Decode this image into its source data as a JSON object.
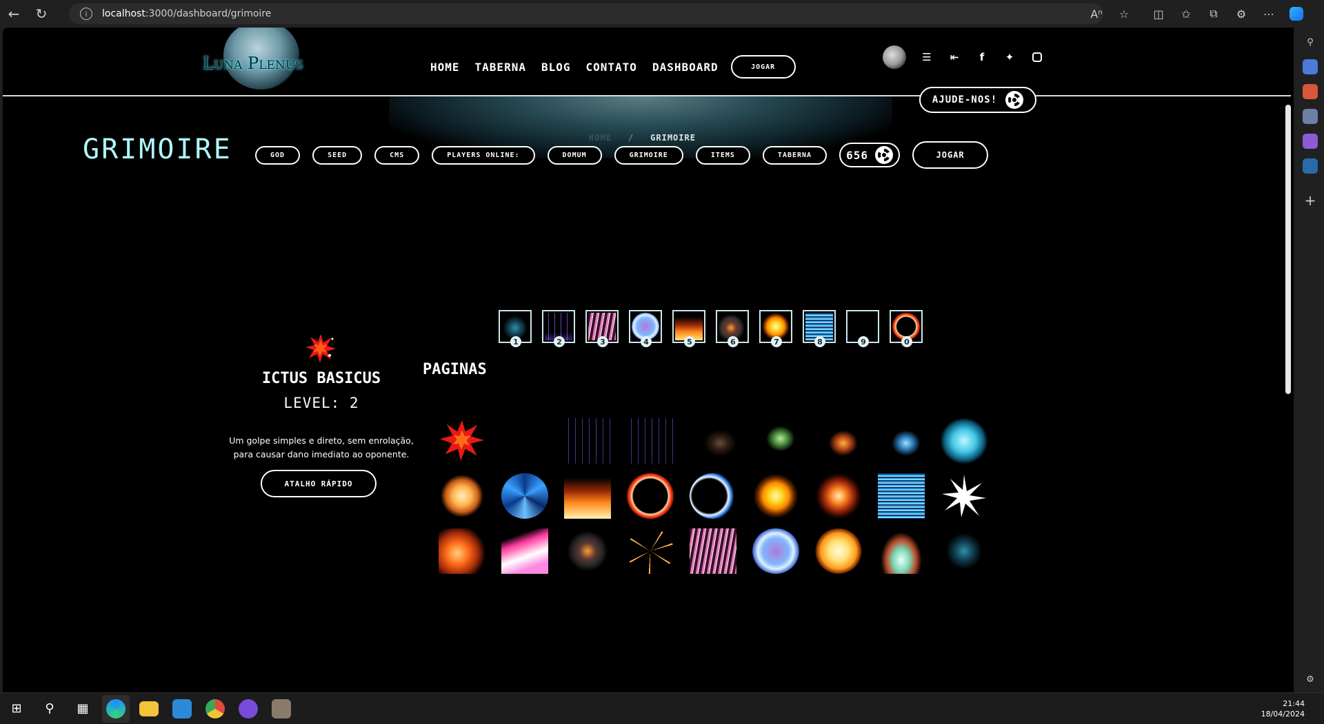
{
  "browser": {
    "url_host": "localhost",
    "url_path": ":3000/dashboard/grimoire"
  },
  "header": {
    "logo_text": "Luna Plenus",
    "nav": [
      "HOME",
      "TABERNA",
      "BLOG",
      "CONTATO",
      "DASHBOARD"
    ],
    "play_label": "JOGAR"
  },
  "hero": {
    "breadcrumb_home": "HOME",
    "breadcrumb_sep": "/",
    "breadcrumb_current": "GRIMOIRE",
    "help_label": "AJUDE-NOS!"
  },
  "page": {
    "title": "GRIMOIRE",
    "subnav": [
      "GOD",
      "SEED",
      "CMS",
      "PLAYERS ONLINE:",
      "DOMUM",
      "GRIMOIRE",
      "ITEMS",
      "TABERNA"
    ],
    "counter": "656",
    "play_label": "JOGAR"
  },
  "spell": {
    "name": "ICTUS BASICUS",
    "level": "LEVEL: 2",
    "description": "Um golpe simples e direto, sem enrolação, para causar dano imediato ao oponente.",
    "shortcut_label": "ATALHO RÁPIDO"
  },
  "hotbar_keys": [
    "1",
    "2",
    "3",
    "4",
    "5",
    "6",
    "7",
    "8",
    "9",
    "0"
  ],
  "pages_title": "PAGINAS",
  "taskbar": {
    "time": "21:44",
    "date": "18/04/2024"
  },
  "colors": {
    "accent": "#aef7ff",
    "page_bg": "#000000"
  }
}
